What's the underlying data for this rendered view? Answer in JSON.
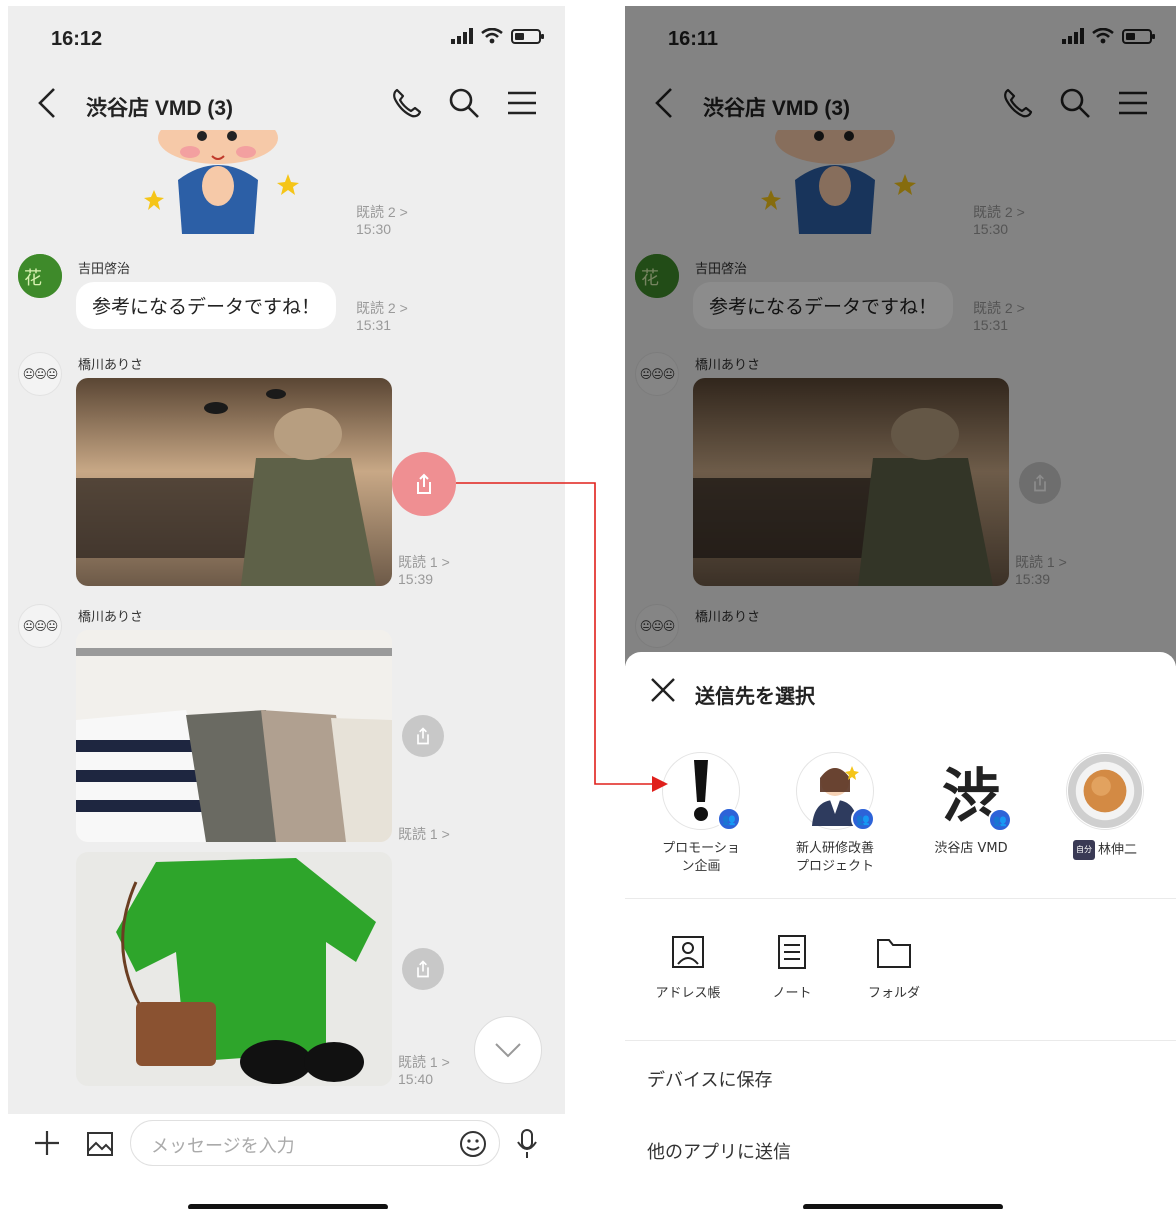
{
  "left": {
    "status_time": "16:12",
    "chat_title": "渋谷店 VMD (3)",
    "sticker_read": "既読 2 >",
    "sticker_time": "15:30",
    "msg1_sender": "吉田啓治",
    "msg1_text": "参考になるデータですね！",
    "msg1_read": "既読 2 >",
    "msg1_time": "15:31",
    "msg2_sender": "橋川ありさ",
    "msg2_read": "既読 1 >",
    "msg2_time": "15:39",
    "msg3_sender": "橋川ありさ",
    "msg3_read": "既読 1 >",
    "msg4_read": "既読 1 >",
    "msg4_time": "15:40",
    "input_placeholder": "メッセージを入力"
  },
  "right": {
    "status_time": "16:11",
    "chat_title": "渋谷店 VMD (3)",
    "sticker_read": "既読 2 >",
    "sticker_time": "15:30",
    "msg1_sender": "吉田啓治",
    "msg1_text": "参考になるデータですね！",
    "msg1_read": "既読 2 >",
    "msg1_time": "15:31",
    "msg2_sender": "橋川ありさ",
    "msg2_read": "既読 1 >",
    "msg2_time": "15:39",
    "msg3_sender": "橋川ありさ",
    "sheet_title": "送信先を選択",
    "contacts": [
      {
        "name_line1": "プロモーショ",
        "name_line2": "ン企画"
      },
      {
        "name_line1": "新人研修改善",
        "name_line2": "プロジェクト"
      },
      {
        "name_line1": "渋谷店 VMD",
        "name_line2": ""
      },
      {
        "tag": "自分",
        "name_line1": "林伸二",
        "name_line2": ""
      }
    ],
    "options": [
      "アドレス帳",
      "ノート",
      "フォルダ"
    ],
    "save_to_device": "デバイスに保存",
    "send_to_other_app": "他のアプリに送信",
    "shibuya_glyph": "渋",
    "group_badge": "👥"
  },
  "colors": {
    "highlight": "#ef8f92",
    "connector": "#e0201c",
    "badge": "#2d63d8",
    "chat_bg": "#eeeeee"
  }
}
